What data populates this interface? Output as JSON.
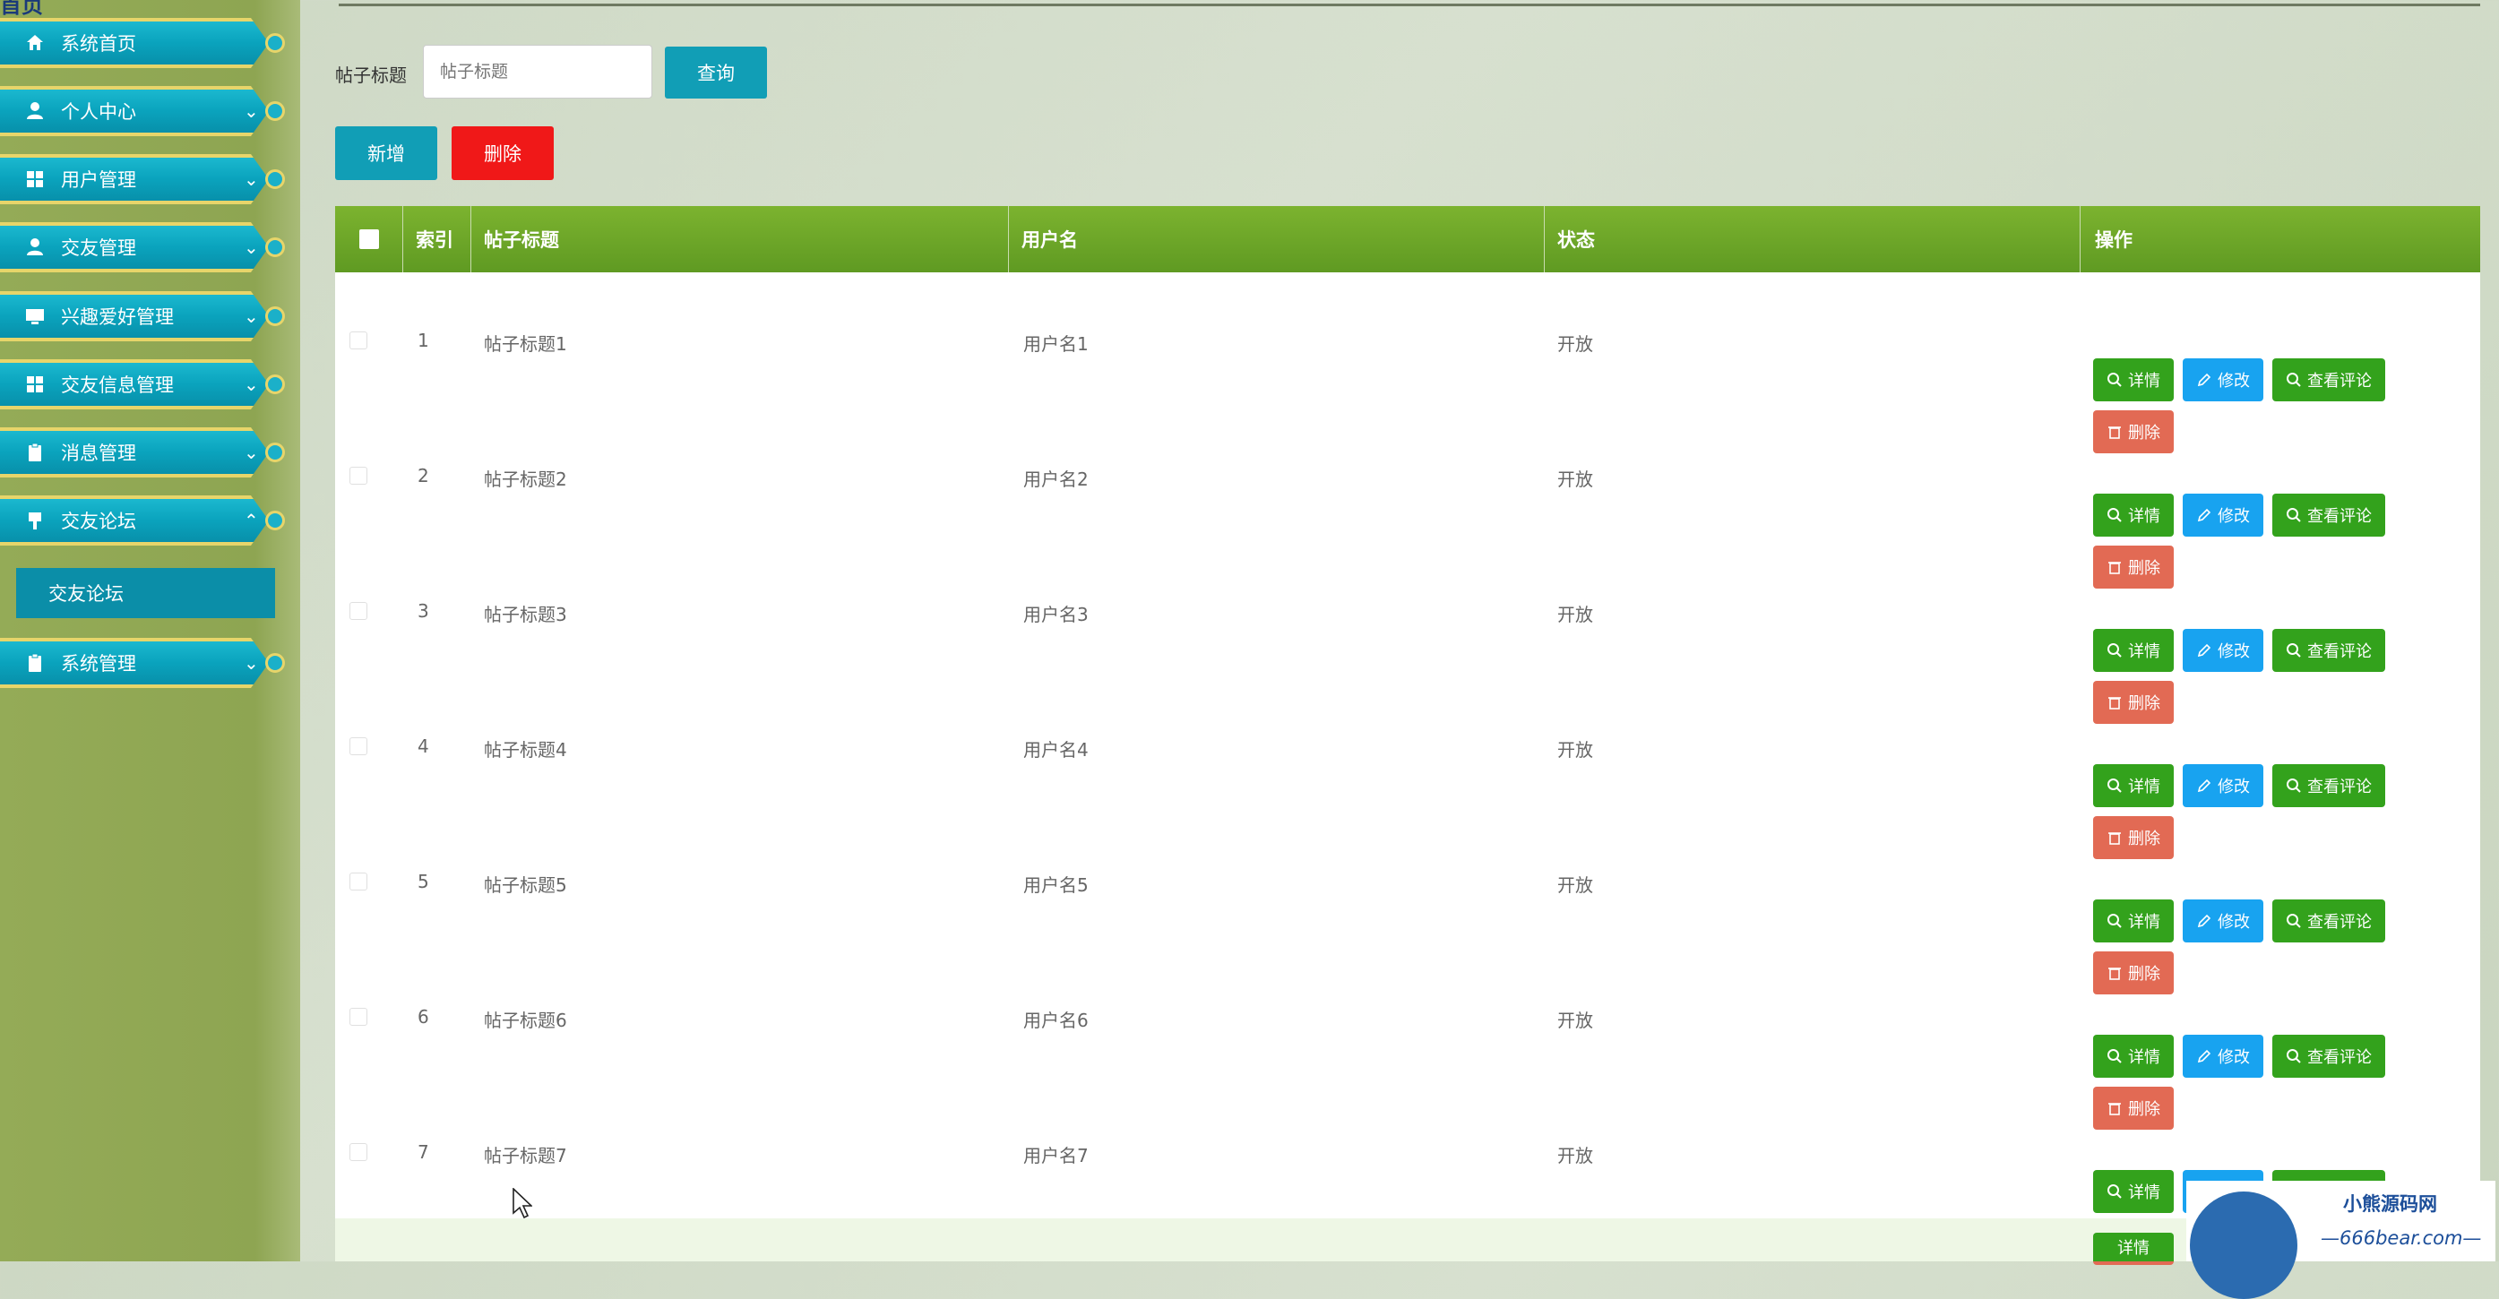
{
  "sidebar": {
    "top_text": "首页",
    "items": [
      {
        "label": "系统首页",
        "icon": "home-icon"
      },
      {
        "label": "个人中心",
        "icon": "user-icon"
      },
      {
        "label": "用户管理",
        "icon": "grid-icon"
      },
      {
        "label": "交友管理",
        "icon": "user-icon"
      },
      {
        "label": "兴趣爱好管理",
        "icon": "monitor-icon"
      },
      {
        "label": "交友信息管理",
        "icon": "grid-icon"
      },
      {
        "label": "消息管理",
        "icon": "clipboard-icon"
      },
      {
        "label": "交友论坛",
        "icon": "pin-icon"
      },
      {
        "label": "系统管理",
        "icon": "clipboard-icon"
      }
    ],
    "sub_item": "交友论坛"
  },
  "search": {
    "label": "帖子标题",
    "placeholder": "帖子标题",
    "query_button": "查询"
  },
  "toolbar": {
    "add_button": "新增",
    "delete_button": "删除"
  },
  "table": {
    "headers": {
      "index": "索引",
      "title": "帖子标题",
      "user": "用户名",
      "status": "状态",
      "action": "操作"
    },
    "rows": [
      {
        "index": "1",
        "title": "帖子标题1",
        "user": "用户名1",
        "status": "开放"
      },
      {
        "index": "2",
        "title": "帖子标题2",
        "user": "用户名2",
        "status": "开放"
      },
      {
        "index": "3",
        "title": "帖子标题3",
        "user": "用户名3",
        "status": "开放"
      },
      {
        "index": "4",
        "title": "帖子标题4",
        "user": "用户名4",
        "status": "开放"
      },
      {
        "index": "5",
        "title": "帖子标题5",
        "user": "用户名5",
        "status": "开放"
      },
      {
        "index": "6",
        "title": "帖子标题6",
        "user": "用户名6",
        "status": "开放"
      },
      {
        "index": "7",
        "title": "帖子标题7",
        "user": "用户名7",
        "status": "开放"
      }
    ],
    "action_labels": {
      "detail": "详情",
      "edit": "修改",
      "view_comments": "查看评论",
      "delete": "删除"
    },
    "partial_row_detail": "详情"
  },
  "watermark": {
    "name": "小熊源码网",
    "url": "—666bear.com—"
  },
  "colors": {
    "accent_teal": "#119eb6",
    "header_green": "#6aa628",
    "delete_red": "#f01818",
    "btn_green": "#33a21c",
    "btn_blue": "#18a3f0",
    "btn_delete": "#e26a54"
  }
}
